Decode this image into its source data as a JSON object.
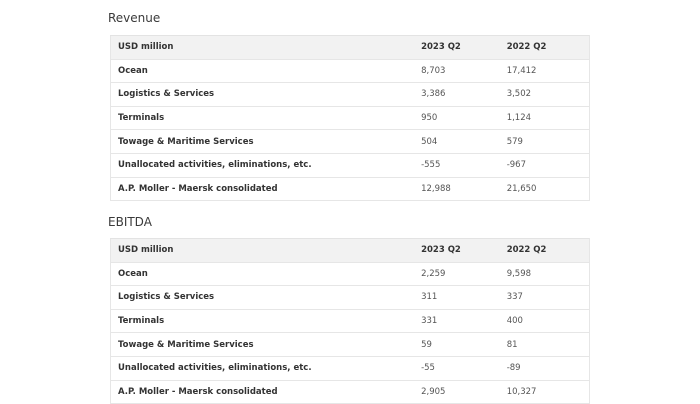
{
  "revenue": {
    "title": "Revenue",
    "headers": [
      "USD million",
      "2023 Q2",
      "2022 Q2"
    ],
    "rows": [
      [
        "Ocean",
        "8,703",
        "17,412"
      ],
      [
        "Logistics & Services",
        "3,386",
        "3,502"
      ],
      [
        "Terminals",
        "950",
        "1,124"
      ],
      [
        "Towage & Maritime Services",
        "504",
        "579"
      ],
      [
        "Unallocated activities, eliminations, etc.",
        "-555",
        "-967"
      ],
      [
        "A.P. Moller - Maersk consolidated",
        "12,988",
        "21,650"
      ]
    ]
  },
  "ebitda": {
    "title": "EBITDA",
    "headers": [
      "USD million",
      "2023 Q2",
      "2022 Q2"
    ],
    "rows": [
      [
        "Ocean",
        "2,259",
        "9,598"
      ],
      [
        "Logistics & Services",
        "311",
        "337"
      ],
      [
        "Terminals",
        "331",
        "400"
      ],
      [
        "Towage & Maritime Services",
        "59",
        "81"
      ],
      [
        "Unallocated activities, eliminations, etc.",
        "-55",
        "-89"
      ],
      [
        "A.P. Moller - Maersk consolidated",
        "2,905",
        "10,327"
      ]
    ]
  }
}
